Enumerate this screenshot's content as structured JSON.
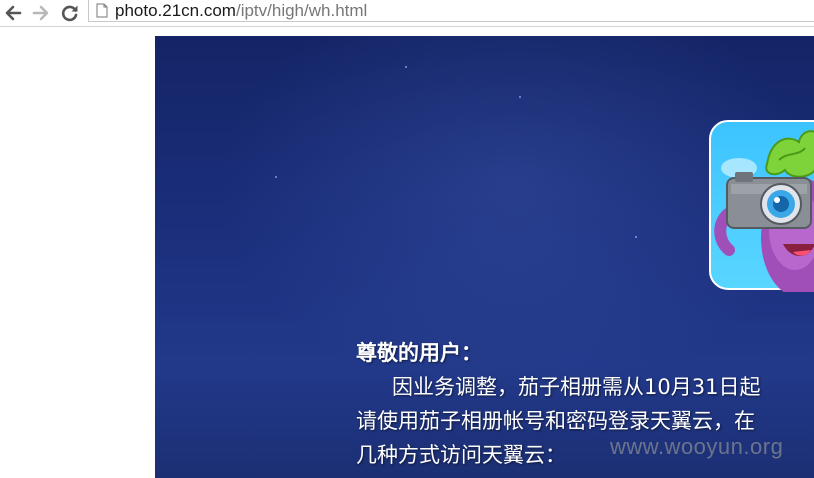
{
  "browser": {
    "url_host": "photo.21cn.com",
    "url_path": "/iptv/high/wh.html"
  },
  "notice": {
    "greeting": "尊敬的用户：",
    "line1": "因业务调整，茄子相册需从10月31日起",
    "line2": "请使用茄子相册帐号和密码登录天翼云，在",
    "line3": "几种方式访问天翼云："
  },
  "watermark": "www.wooyun.org",
  "colors": {
    "banner_top": "#142466",
    "banner_bottom": "#22398a",
    "text": "#ffffff"
  }
}
